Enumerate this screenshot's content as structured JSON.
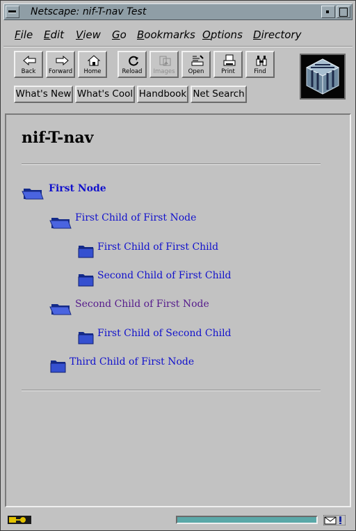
{
  "window": {
    "title": "Netscape: nif-T-nav Test"
  },
  "menubar": {
    "items": [
      {
        "key": "F",
        "rest": "ile"
      },
      {
        "key": "E",
        "rest": "dit"
      },
      {
        "key": "V",
        "rest": "iew"
      },
      {
        "key": "G",
        "rest": "o"
      },
      {
        "key": "B",
        "rest": "ookmarks"
      },
      {
        "key": "O",
        "rest": "ptions"
      },
      {
        "key": "D",
        "rest": "irectory"
      }
    ]
  },
  "toolbar": {
    "buttons": [
      {
        "label": "Back",
        "icon": "back-arrow-icon"
      },
      {
        "label": "Forward",
        "icon": "forward-arrow-icon"
      },
      {
        "label": "Home",
        "icon": "home-icon"
      },
      {
        "label": "Reload",
        "icon": "reload-icon"
      },
      {
        "label": "Images",
        "icon": "images-icon",
        "disabled": true
      },
      {
        "label": "Open",
        "icon": "open-icon"
      },
      {
        "label": "Print",
        "icon": "print-icon"
      },
      {
        "label": "Find",
        "icon": "find-icon"
      }
    ]
  },
  "directory_buttons": [
    "What's New",
    "What's Cool",
    "Handbook",
    "Net Search"
  ],
  "page": {
    "title": "nif-T-nav",
    "tree": [
      {
        "label": "First Node",
        "open": true,
        "bold": true
      },
      {
        "label": "First Child of First Node",
        "open": true
      },
      {
        "label": "First Child of First Child",
        "open": false
      },
      {
        "label": "Second Child of First Child",
        "open": false
      },
      {
        "label": "Second Child of First Node",
        "open": true,
        "visited": true
      },
      {
        "label": "First Child of Second Child",
        "open": false
      },
      {
        "label": "Third Child of First Node",
        "open": false
      }
    ]
  },
  "status": {
    "progress": 1.0
  },
  "colors": {
    "link": "#1111cc",
    "visited_link": "#551a8b",
    "folder": "#2a3fb8",
    "progress": "#5aa8a8",
    "titlebar": "#8f9ea6"
  }
}
